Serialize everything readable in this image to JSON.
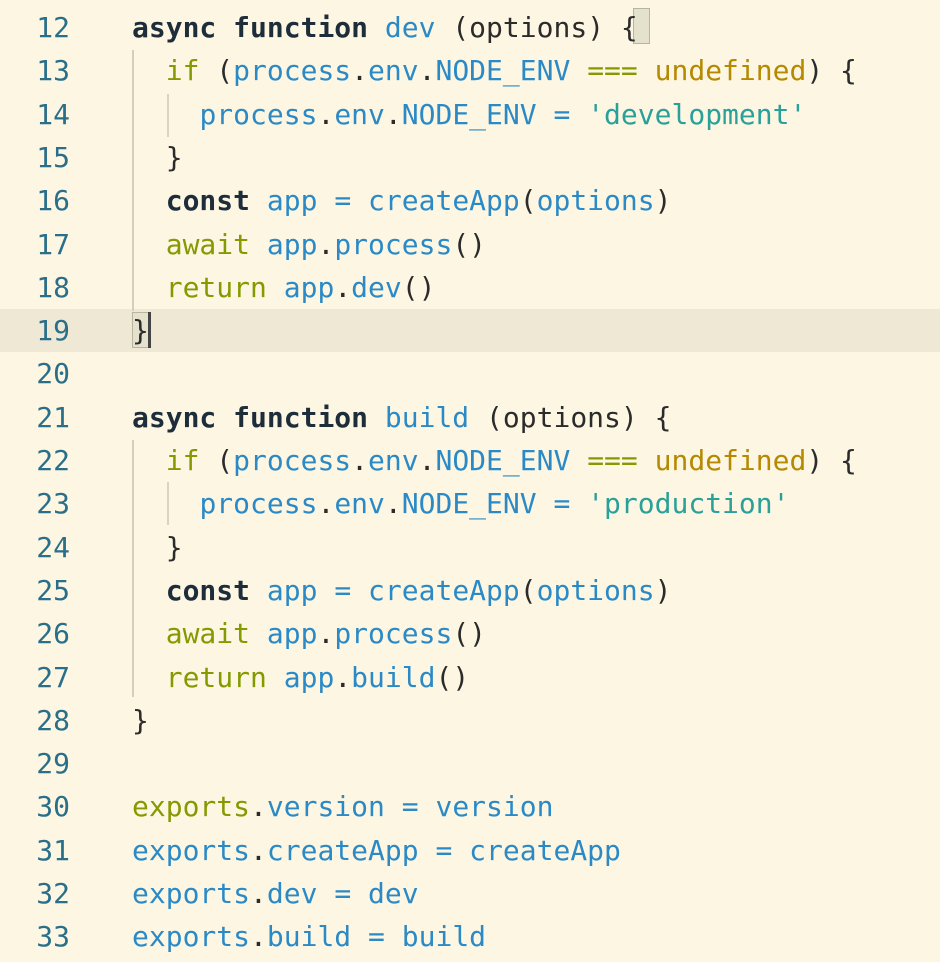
{
  "editor": {
    "theme": {
      "background": "#fdf6e3",
      "current_line": "#eee8d5",
      "keyword": "#1e2d3a",
      "identifier": "#2b8ac6",
      "control": "#859900",
      "constant": "#b58900",
      "string": "#2aa198",
      "line_number": "#2a6f8a"
    },
    "current_line_number": "19",
    "lines": [
      {
        "num": "12",
        "tokens": [
          {
            "t": "async",
            "c": "kw"
          },
          {
            "t": " ",
            "c": "punc"
          },
          {
            "t": "function",
            "c": "kw"
          },
          {
            "t": " ",
            "c": "punc"
          },
          {
            "t": "dev",
            "c": "fn"
          },
          {
            "t": " (",
            "c": "paren"
          },
          {
            "t": "options",
            "c": "paren"
          },
          {
            "t": ") ",
            "c": "paren"
          },
          {
            "t": "{",
            "c": "punc"
          }
        ]
      },
      {
        "num": "13",
        "tokens": [
          {
            "t": "  ",
            "c": "punc"
          },
          {
            "t": "if",
            "c": "ctl"
          },
          {
            "t": " (",
            "c": "paren"
          },
          {
            "t": "process",
            "c": "id"
          },
          {
            "t": ".",
            "c": "dot"
          },
          {
            "t": "env",
            "c": "id"
          },
          {
            "t": ".",
            "c": "dot"
          },
          {
            "t": "NODE_ENV",
            "c": "id"
          },
          {
            "t": " ",
            "c": "punc"
          },
          {
            "t": "===",
            "c": "ctl"
          },
          {
            "t": " ",
            "c": "punc"
          },
          {
            "t": "undefined",
            "c": "undef"
          },
          {
            "t": ") {",
            "c": "paren"
          }
        ]
      },
      {
        "num": "14",
        "tokens": [
          {
            "t": "    ",
            "c": "punc"
          },
          {
            "t": "process",
            "c": "id"
          },
          {
            "t": ".",
            "c": "dot"
          },
          {
            "t": "env",
            "c": "id"
          },
          {
            "t": ".",
            "c": "dot"
          },
          {
            "t": "NODE_ENV",
            "c": "id"
          },
          {
            "t": " ",
            "c": "punc"
          },
          {
            "t": "=",
            "c": "op"
          },
          {
            "t": " ",
            "c": "punc"
          },
          {
            "t": "'development'",
            "c": "str"
          }
        ]
      },
      {
        "num": "15",
        "tokens": [
          {
            "t": "  ",
            "c": "punc"
          },
          {
            "t": "}",
            "c": "punc"
          }
        ]
      },
      {
        "num": "16",
        "tokens": [
          {
            "t": "  ",
            "c": "punc"
          },
          {
            "t": "const",
            "c": "kw"
          },
          {
            "t": " ",
            "c": "punc"
          },
          {
            "t": "app",
            "c": "id"
          },
          {
            "t": " ",
            "c": "punc"
          },
          {
            "t": "=",
            "c": "op"
          },
          {
            "t": " ",
            "c": "punc"
          },
          {
            "t": "createApp",
            "c": "fn"
          },
          {
            "t": "(",
            "c": "paren"
          },
          {
            "t": "options",
            "c": "id"
          },
          {
            "t": ")",
            "c": "paren"
          }
        ]
      },
      {
        "num": "17",
        "tokens": [
          {
            "t": "  ",
            "c": "punc"
          },
          {
            "t": "await",
            "c": "ctl"
          },
          {
            "t": " ",
            "c": "punc"
          },
          {
            "t": "app",
            "c": "id"
          },
          {
            "t": ".",
            "c": "dot"
          },
          {
            "t": "process",
            "c": "fn"
          },
          {
            "t": "()",
            "c": "paren"
          }
        ]
      },
      {
        "num": "18",
        "tokens": [
          {
            "t": "  ",
            "c": "punc"
          },
          {
            "t": "return",
            "c": "ctl"
          },
          {
            "t": " ",
            "c": "punc"
          },
          {
            "t": "app",
            "c": "id"
          },
          {
            "t": ".",
            "c": "dot"
          },
          {
            "t": "dev",
            "c": "fn"
          },
          {
            "t": "()",
            "c": "paren"
          }
        ]
      },
      {
        "num": "19",
        "tokens": [
          {
            "t": "}",
            "c": "punc"
          }
        ]
      },
      {
        "num": "20",
        "tokens": []
      },
      {
        "num": "21",
        "tokens": [
          {
            "t": "async",
            "c": "kw"
          },
          {
            "t": " ",
            "c": "punc"
          },
          {
            "t": "function",
            "c": "kw"
          },
          {
            "t": " ",
            "c": "punc"
          },
          {
            "t": "build",
            "c": "fn"
          },
          {
            "t": " (",
            "c": "paren"
          },
          {
            "t": "options",
            "c": "paren"
          },
          {
            "t": ") {",
            "c": "paren"
          }
        ]
      },
      {
        "num": "22",
        "tokens": [
          {
            "t": "  ",
            "c": "punc"
          },
          {
            "t": "if",
            "c": "ctl"
          },
          {
            "t": " (",
            "c": "paren"
          },
          {
            "t": "process",
            "c": "id"
          },
          {
            "t": ".",
            "c": "dot"
          },
          {
            "t": "env",
            "c": "id"
          },
          {
            "t": ".",
            "c": "dot"
          },
          {
            "t": "NODE_ENV",
            "c": "id"
          },
          {
            "t": " ",
            "c": "punc"
          },
          {
            "t": "===",
            "c": "ctl"
          },
          {
            "t": " ",
            "c": "punc"
          },
          {
            "t": "undefined",
            "c": "undef"
          },
          {
            "t": ") {",
            "c": "paren"
          }
        ]
      },
      {
        "num": "23",
        "tokens": [
          {
            "t": "    ",
            "c": "punc"
          },
          {
            "t": "process",
            "c": "id"
          },
          {
            "t": ".",
            "c": "dot"
          },
          {
            "t": "env",
            "c": "id"
          },
          {
            "t": ".",
            "c": "dot"
          },
          {
            "t": "NODE_ENV",
            "c": "id"
          },
          {
            "t": " ",
            "c": "punc"
          },
          {
            "t": "=",
            "c": "op"
          },
          {
            "t": " ",
            "c": "punc"
          },
          {
            "t": "'production'",
            "c": "str"
          }
        ]
      },
      {
        "num": "24",
        "tokens": [
          {
            "t": "  ",
            "c": "punc"
          },
          {
            "t": "}",
            "c": "punc"
          }
        ]
      },
      {
        "num": "25",
        "tokens": [
          {
            "t": "  ",
            "c": "punc"
          },
          {
            "t": "const",
            "c": "kw"
          },
          {
            "t": " ",
            "c": "punc"
          },
          {
            "t": "app",
            "c": "id"
          },
          {
            "t": " ",
            "c": "punc"
          },
          {
            "t": "=",
            "c": "op"
          },
          {
            "t": " ",
            "c": "punc"
          },
          {
            "t": "createApp",
            "c": "fn"
          },
          {
            "t": "(",
            "c": "paren"
          },
          {
            "t": "options",
            "c": "id"
          },
          {
            "t": ")",
            "c": "paren"
          }
        ]
      },
      {
        "num": "26",
        "tokens": [
          {
            "t": "  ",
            "c": "punc"
          },
          {
            "t": "await",
            "c": "ctl"
          },
          {
            "t": " ",
            "c": "punc"
          },
          {
            "t": "app",
            "c": "id"
          },
          {
            "t": ".",
            "c": "dot"
          },
          {
            "t": "process",
            "c": "fn"
          },
          {
            "t": "()",
            "c": "paren"
          }
        ]
      },
      {
        "num": "27",
        "tokens": [
          {
            "t": "  ",
            "c": "punc"
          },
          {
            "t": "return",
            "c": "ctl"
          },
          {
            "t": " ",
            "c": "punc"
          },
          {
            "t": "app",
            "c": "id"
          },
          {
            "t": ".",
            "c": "dot"
          },
          {
            "t": "build",
            "c": "fn"
          },
          {
            "t": "()",
            "c": "paren"
          }
        ]
      },
      {
        "num": "28",
        "tokens": [
          {
            "t": "}",
            "c": "punc"
          }
        ]
      },
      {
        "num": "29",
        "tokens": []
      },
      {
        "num": "30",
        "tokens": [
          {
            "t": "exports",
            "c": "ctl"
          },
          {
            "t": ".",
            "c": "dot"
          },
          {
            "t": "version",
            "c": "id"
          },
          {
            "t": " ",
            "c": "punc"
          },
          {
            "t": "=",
            "c": "op"
          },
          {
            "t": " ",
            "c": "punc"
          },
          {
            "t": "version",
            "c": "id"
          }
        ]
      },
      {
        "num": "31",
        "tokens": [
          {
            "t": "exports",
            "c": "id"
          },
          {
            "t": ".",
            "c": "dot"
          },
          {
            "t": "createApp",
            "c": "id"
          },
          {
            "t": " ",
            "c": "punc"
          },
          {
            "t": "=",
            "c": "op"
          },
          {
            "t": " ",
            "c": "punc"
          },
          {
            "t": "createApp",
            "c": "id"
          }
        ]
      },
      {
        "num": "32",
        "tokens": [
          {
            "t": "exports",
            "c": "id"
          },
          {
            "t": ".",
            "c": "dot"
          },
          {
            "t": "dev",
            "c": "id"
          },
          {
            "t": " ",
            "c": "punc"
          },
          {
            "t": "=",
            "c": "op"
          },
          {
            "t": " ",
            "c": "punc"
          },
          {
            "t": "dev",
            "c": "id"
          }
        ]
      },
      {
        "num": "33",
        "tokens": [
          {
            "t": "exports",
            "c": "id"
          },
          {
            "t": ".",
            "c": "dot"
          },
          {
            "t": "build",
            "c": "id"
          },
          {
            "t": " ",
            "c": "punc"
          },
          {
            "t": "=",
            "c": "op"
          },
          {
            "t": " ",
            "c": "punc"
          },
          {
            "t": "build",
            "c": "id"
          }
        ]
      }
    ]
  }
}
